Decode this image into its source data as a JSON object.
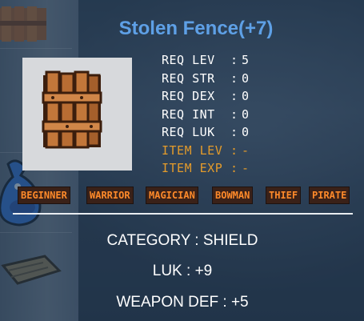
{
  "item": {
    "name": "Stolen Fence(+7)",
    "icon": "wooden-fence-shield-icon"
  },
  "requirements": [
    {
      "label": "REQ LEV",
      "value": "5",
      "dim": false
    },
    {
      "label": "REQ STR",
      "value": "0",
      "dim": false
    },
    {
      "label": "REQ DEX",
      "value": "0",
      "dim": false
    },
    {
      "label": "REQ INT",
      "value": "0",
      "dim": false
    },
    {
      "label": "REQ LUK",
      "value": "0",
      "dim": false
    },
    {
      "label": "ITEM LEV",
      "value": "-",
      "dim": true
    },
    {
      "label": "ITEM EXP",
      "value": "-",
      "dim": true
    }
  ],
  "jobs": [
    "BEGINNER",
    "WARRIOR",
    "MAGICIAN",
    "BOWMAN",
    "THIEF",
    "PIRATE"
  ],
  "details": {
    "category": "CATEGORY : SHIELD",
    "luk": "LUK : +9",
    "weapon_def": "WEAPON DEF : +5"
  },
  "colors": {
    "title": "#5ea0e6",
    "dim_stat": "#e39b2b",
    "job_text": "#ff8a2a",
    "job_bg": "#3a2118"
  },
  "background_items": [
    "fence-item-icon",
    "potion-flask-icon",
    "log-item-icon"
  ]
}
